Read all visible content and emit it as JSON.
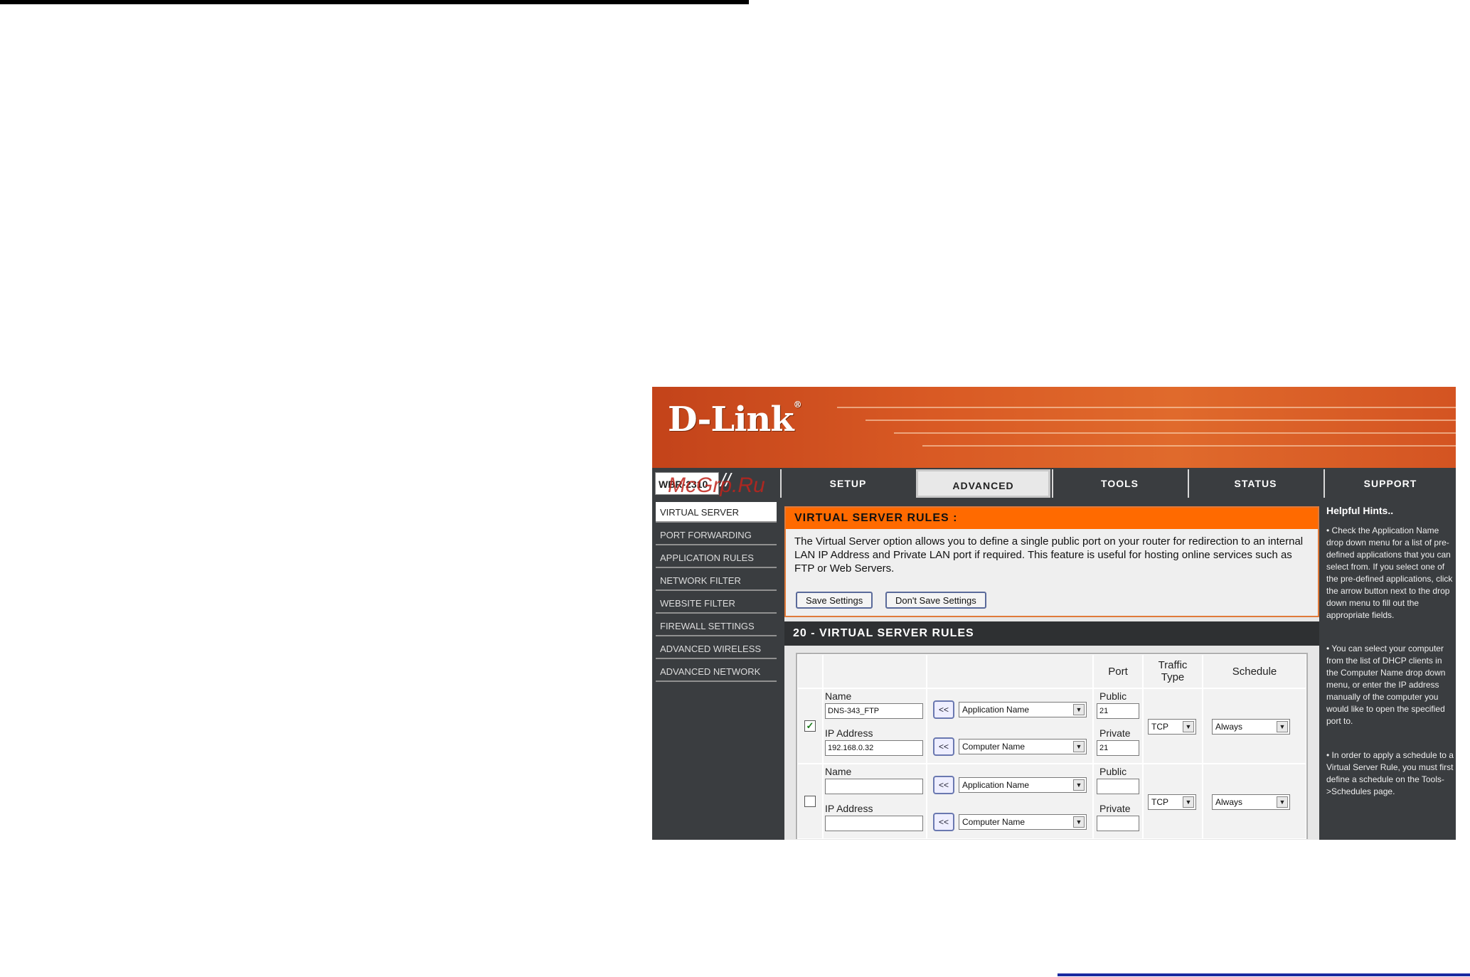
{
  "brand": {
    "logo": "D-Link",
    "registered": "®",
    "model": "WBR-2310",
    "watermark": "McGrp.Ru"
  },
  "tabs": [
    {
      "label": "SETUP"
    },
    {
      "label": "ADVANCED"
    },
    {
      "label": "TOOLS"
    },
    {
      "label": "STATUS"
    },
    {
      "label": "SUPPORT"
    }
  ],
  "sidebar": {
    "items": [
      {
        "label": "VIRTUAL SERVER"
      },
      {
        "label": "PORT FORWARDING"
      },
      {
        "label": "APPLICATION RULES"
      },
      {
        "label": "NETWORK FILTER"
      },
      {
        "label": "WEBSITE FILTER"
      },
      {
        "label": "FIREWALL SETTINGS"
      },
      {
        "label": "ADVANCED WIRELESS"
      },
      {
        "label": "ADVANCED NETWORK"
      }
    ]
  },
  "intro": {
    "title": "VIRTUAL SERVER RULES :",
    "text": "The Virtual Server option allows you to define a single public port on your router for redirection to an internal LAN IP Address and Private LAN port if required. This feature is useful for hosting online services such as FTP or Web Servers.",
    "save_label": "Save Settings",
    "dont_save_label": "Don't Save Settings"
  },
  "rules": {
    "title": "20 - VIRTUAL SERVER RULES",
    "headers": {
      "port": "Port",
      "traffic": "Traffic Type",
      "schedule": "Schedule"
    },
    "labels": {
      "name": "Name",
      "ip": "IP Address",
      "public": "Public",
      "private": "Private",
      "copy": "<<"
    },
    "rows": [
      {
        "checked": "✓",
        "name": "DNS-343_FTP",
        "ip": "192.168.0.32",
        "app": "Application Name",
        "computer": "Computer Name",
        "public": "21",
        "private": "21",
        "traffic": "TCP",
        "schedule": "Always"
      },
      {
        "checked": "",
        "name": "",
        "ip": "",
        "app": "Application Name",
        "computer": "Computer Name",
        "public": "",
        "private": "",
        "traffic": "TCP",
        "schedule": "Always"
      }
    ]
  },
  "hints": {
    "title": "Helpful Hints..",
    "items": [
      "• Check the Application Name drop down menu for a list of pre-defined applications that you can select from. If you select one of the pre-defined applications, click the arrow button next to the drop down menu to fill out the appropriate fields.",
      "• You can select your computer from the list of DHCP clients in the Computer Name drop down menu, or enter the IP address manually of the computer you would like to open the specified port to.",
      "• In order to apply a schedule to a Virtual Server Rule, you must first define a schedule on the Tools->Schedules page."
    ]
  }
}
